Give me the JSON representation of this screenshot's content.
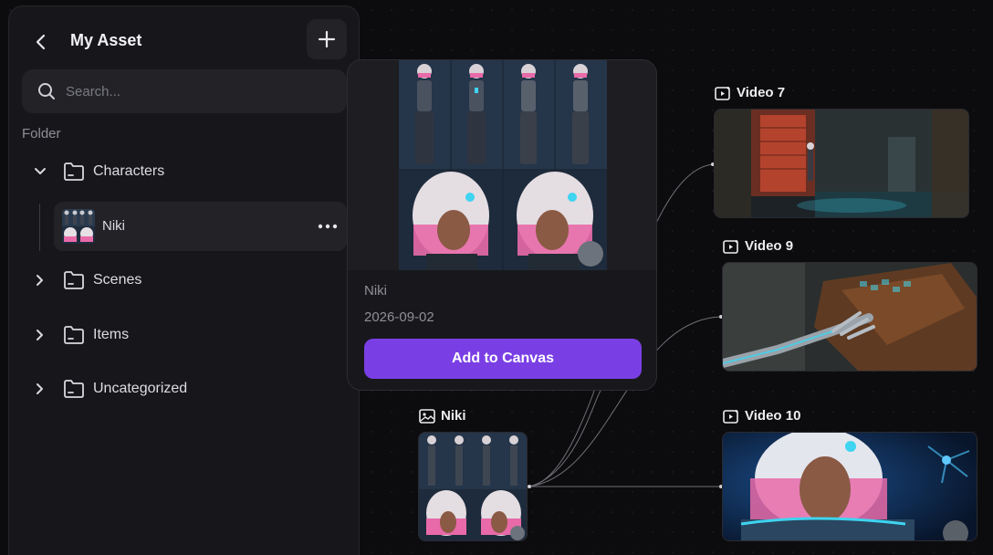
{
  "sidebar": {
    "title": "My Asset",
    "back_icon": "chevron-left-icon",
    "add_icon": "plus-icon",
    "search": {
      "placeholder": "Search...",
      "value": ""
    },
    "folder_section_label": "Folder",
    "folders": [
      {
        "label": "Characters",
        "expanded": true,
        "children": [
          {
            "label": "Niki"
          }
        ]
      },
      {
        "label": "Scenes",
        "expanded": false
      },
      {
        "label": "Items",
        "expanded": false
      },
      {
        "label": "Uncategorized",
        "expanded": false
      }
    ]
  },
  "popup": {
    "name": "Niki",
    "date": "2026-09-02",
    "cta_label": "Add to Canvas"
  },
  "canvas": {
    "source_node": {
      "label": "Niki",
      "icon": "image-icon"
    },
    "video_nodes": [
      {
        "label": "Video 7",
        "icon": "video-icon"
      },
      {
        "label": "Video 9",
        "icon": "video-icon"
      },
      {
        "label": "Video 10",
        "icon": "video-icon"
      }
    ]
  },
  "colors": {
    "accent": "#7a3fe4",
    "panel": "#17171b",
    "background": "#0c0c0e",
    "hair_pink": "#e86aa8",
    "cyan_glow": "#3fd4f0"
  }
}
